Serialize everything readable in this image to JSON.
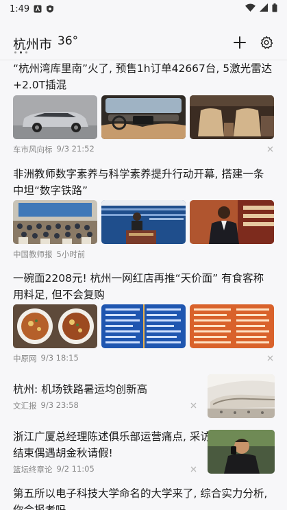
{
  "status": {
    "time": "1:49"
  },
  "header": {
    "city": "杭州市",
    "temperature": "36°"
  },
  "feed": [
    {
      "title": "“杭州湾库里南”火了, 预售1h订单42667台, 5激光雷达+2.0T插混",
      "source": "车市风向标",
      "time": "9/3 21:52"
    },
    {
      "title": "非洲教师数字素养与科学素养提升行动开幕, 搭建一条中坦“数字铁路”",
      "source": "中国教师报",
      "time": "5小时前"
    },
    {
      "title": "一碗面2208元! 杭州一网红店再推“天价面” 有食客称用料足, 但不会复购",
      "source": "中原网",
      "time": "9/3 18:15"
    },
    {
      "title": "杭州: 机场铁路暑运均创新高",
      "source": "文汇报",
      "time": "9/3 23:58"
    },
    {
      "title": "浙江广厦总经理陈述俱乐部运营痛点, 采访结束偶遇胡金秋请假!",
      "source": "篮坛终章论",
      "time": "9/2 11:05"
    },
    {
      "title": "第五所以电子科技大学命名的大学来了, 综合实力分析, 你会报考吗"
    }
  ]
}
